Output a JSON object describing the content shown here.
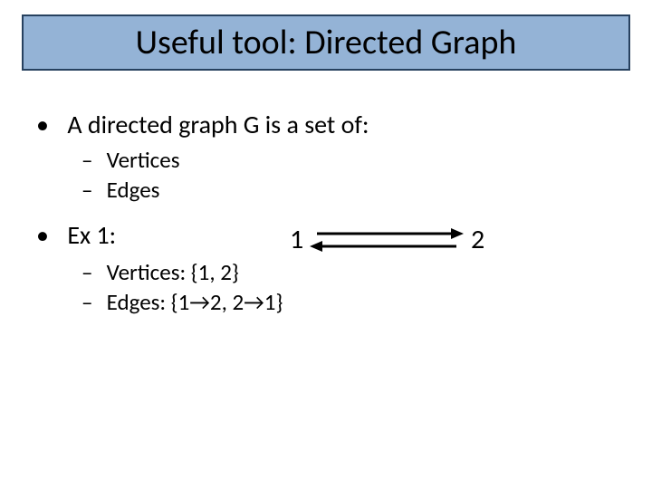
{
  "title": "Useful tool: Directed Graph",
  "bullet1": "A directed graph G is a set of:",
  "sub1a": "Vertices",
  "sub1b": "Edges",
  "ex_label": "Ex 1:",
  "node1": "1",
  "node2": "2",
  "ex_sub1": "Vertices: {1, 2}",
  "ex_sub2": "Edges: {1→2, 2→1}"
}
